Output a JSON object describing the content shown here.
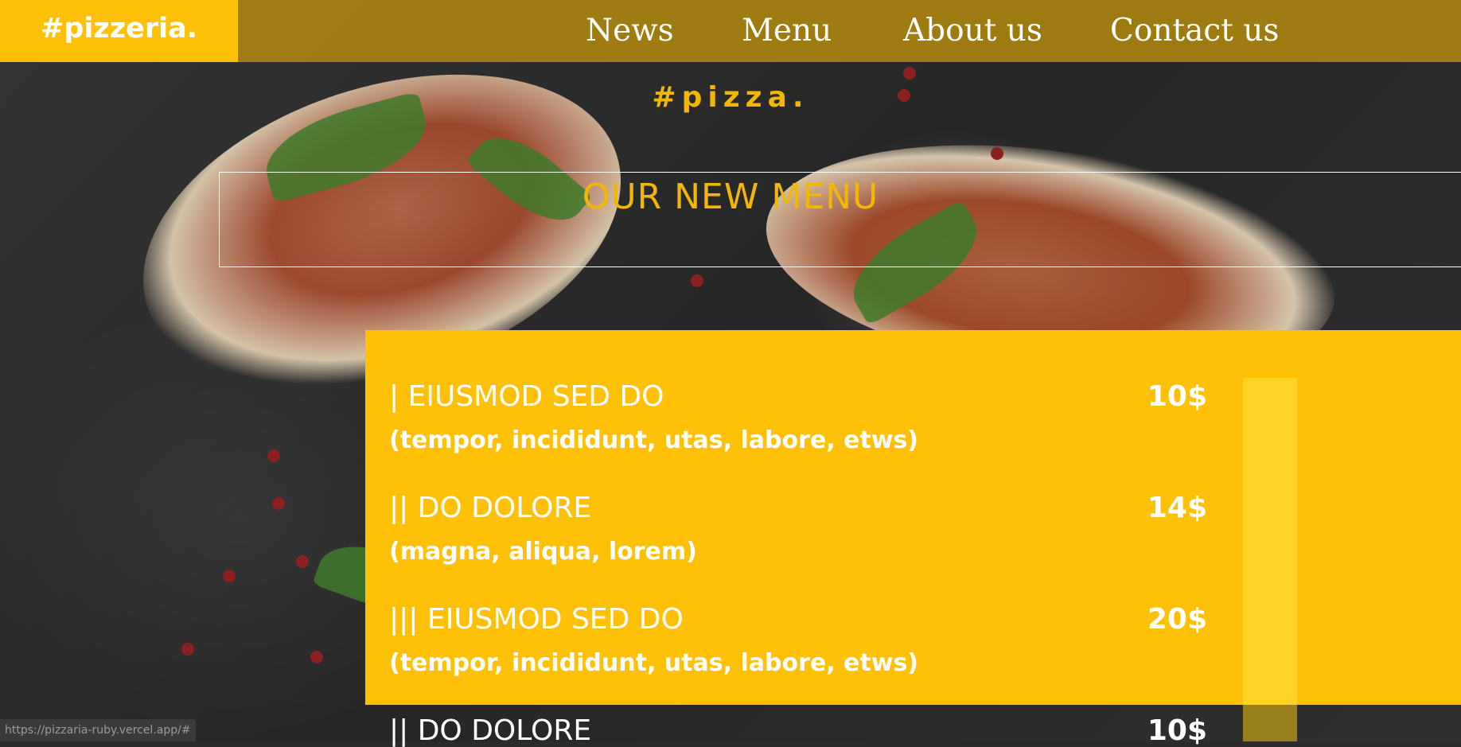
{
  "header": {
    "logo": "#pizzeria.",
    "nav": [
      "News",
      "Menu",
      "About us",
      "Contact us"
    ]
  },
  "hero": {
    "tagline": "#pizza.",
    "section_title": "OUR NEW MENU"
  },
  "menu": {
    "items": [
      {
        "name": "| EIUSMOD SED DO",
        "desc": "(tempor, incididunt, utas, labore, etws)",
        "price": "10$"
      },
      {
        "name": "|| DO DOLORE",
        "desc": "(magna, aliqua, lorem)",
        "price": "14$"
      },
      {
        "name": "||| EIUSMOD SED DO",
        "desc": "(tempor, incididunt, utas, labore, etws)",
        "price": "20$"
      },
      {
        "name": "|| DO DOLORE",
        "price": "10$"
      }
    ]
  },
  "status_bar": {
    "url": "https://pizzaria-ruby.vercel.app/#"
  },
  "colors": {
    "accent": "#ffc107",
    "header_bg": "#af870f",
    "title_text": "#f2b705",
    "scroll_bar": "#ffd324"
  }
}
